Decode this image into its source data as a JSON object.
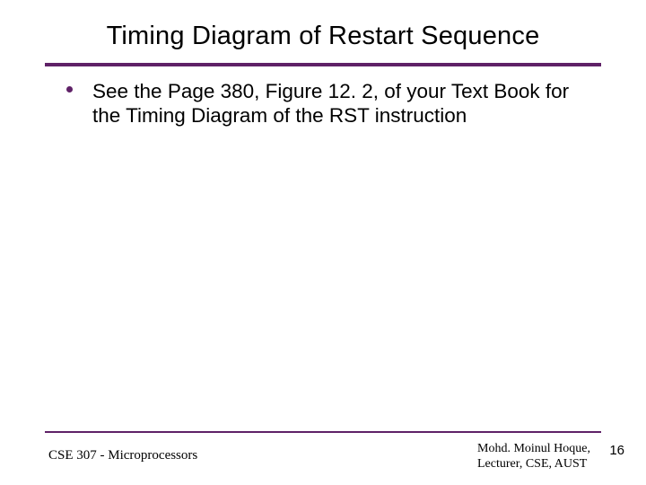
{
  "title": "Timing Diagram of Restart Sequence",
  "bullets": [
    {
      "text": "See the Page 380, Figure 12. 2,  of your Text Book for the Timing Diagram of the RST instruction"
    }
  ],
  "footer": {
    "left": "CSE 307 - Microprocessors",
    "right_line1": "Mohd. Moinul Hoque,",
    "right_line2": "Lecturer, CSE, AUST",
    "page": "16"
  },
  "colors": {
    "accent": "#5f2167"
  }
}
